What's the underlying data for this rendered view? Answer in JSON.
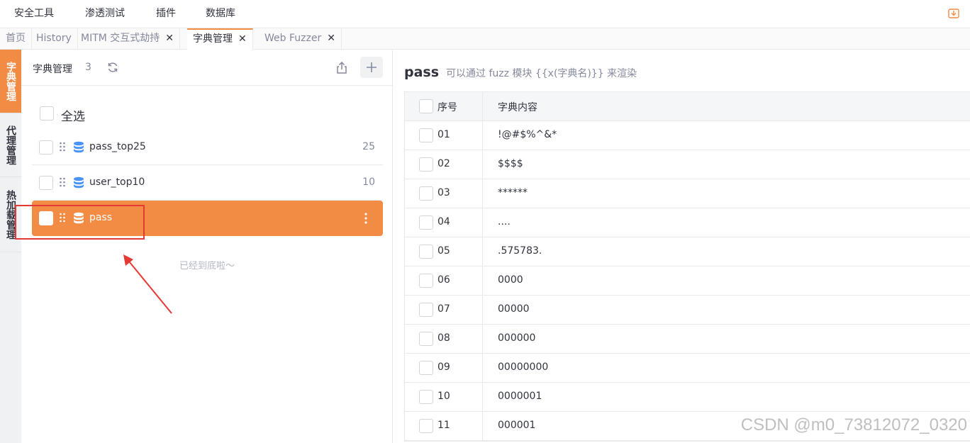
{
  "top_menu": [
    "安全工具",
    "渗透测试",
    "插件",
    "数据库"
  ],
  "tabs": [
    {
      "label": "首页",
      "closable": false
    },
    {
      "label": "History",
      "closable": false
    },
    {
      "label": "MITM 交互式劫持",
      "closable": true
    },
    {
      "label": "字典管理",
      "closable": true,
      "active": true
    },
    {
      "label": "Web Fuzzer",
      "closable": true
    }
  ],
  "close_glyph": "✕",
  "side_nav": [
    "字典管理",
    "代理管理",
    "热加载管理"
  ],
  "dict_panel": {
    "title": "字典管理",
    "count": "3",
    "select_all": "全选",
    "items": [
      {
        "name": "pass_top25",
        "count": "25"
      },
      {
        "name": "user_top10",
        "count": "10"
      },
      {
        "name": "pass",
        "count": ""
      }
    ],
    "end_hint": "已经到底啦～"
  },
  "content": {
    "title": "pass",
    "hint": "可以通过 fuzz 模块 {{x(字典名)}} 来渲染",
    "columns": [
      "序号",
      "字典内容"
    ],
    "rows": [
      {
        "no": "01",
        "value": "!@#$%^&*"
      },
      {
        "no": "02",
        "value": "$$$$"
      },
      {
        "no": "03",
        "value": "******"
      },
      {
        "no": "04",
        "value": "...."
      },
      {
        "no": "05",
        "value": ".575783."
      },
      {
        "no": "06",
        "value": "0000"
      },
      {
        "no": "07",
        "value": "00000"
      },
      {
        "no": "08",
        "value": "000000"
      },
      {
        "no": "09",
        "value": "00000000"
      },
      {
        "no": "10",
        "value": "0000001"
      },
      {
        "no": "11",
        "value": "000001"
      }
    ]
  },
  "watermark": "CSDN @m0_73812072_0320",
  "colors": {
    "accent": "#f28b44",
    "db_icon": "#4a94f8",
    "annotation": "#e53935"
  }
}
